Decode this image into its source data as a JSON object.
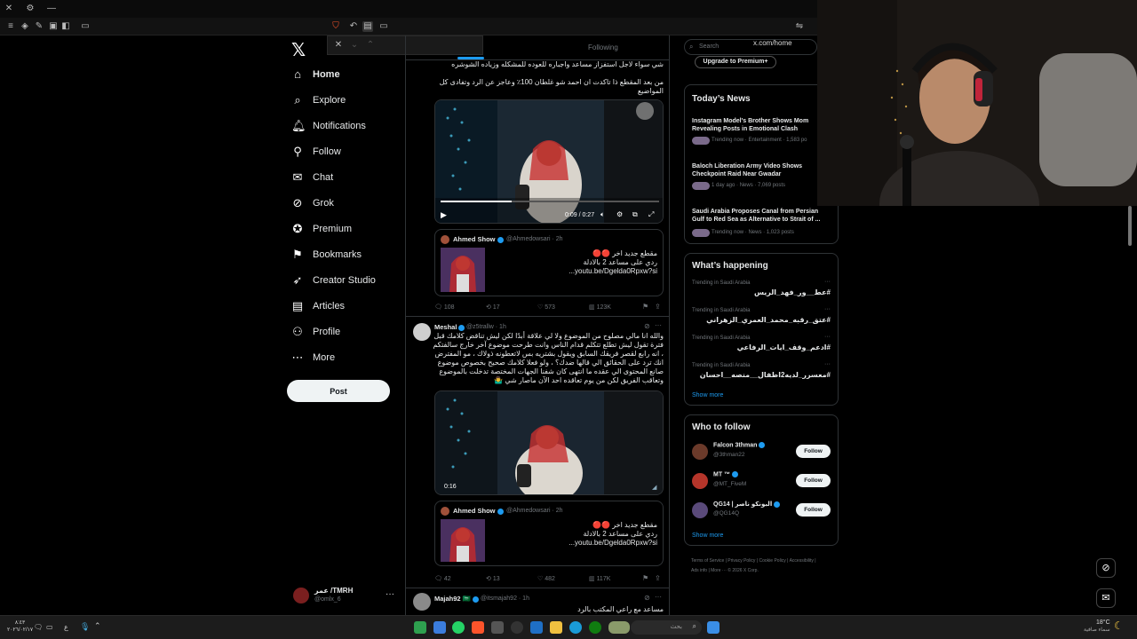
{
  "browser": {
    "url": "x.com/home",
    "title_controls": [
      "✕",
      "⚙",
      "—"
    ]
  },
  "nav": {
    "items": [
      {
        "label": "Home",
        "icon": "home-icon",
        "glyph": "⌂",
        "active": true
      },
      {
        "label": "Explore",
        "icon": "search-icon",
        "glyph": "⌕"
      },
      {
        "label": "Notifications",
        "icon": "bell-icon",
        "glyph": "🔔︎"
      },
      {
        "label": "Follow",
        "icon": "person-plus-icon",
        "glyph": "⚲"
      },
      {
        "label": "Chat",
        "icon": "mail-icon",
        "glyph": "✉"
      },
      {
        "label": "Grok",
        "icon": "grok-icon",
        "glyph": "⊘"
      },
      {
        "label": "Premium",
        "icon": "premium-icon",
        "glyph": "✪"
      },
      {
        "label": "Bookmarks",
        "icon": "bookmark-icon",
        "glyph": "⚑"
      },
      {
        "label": "Creator Studio",
        "icon": "rocket-icon",
        "glyph": "➶"
      },
      {
        "label": "Articles",
        "icon": "articles-icon",
        "glyph": "▤"
      },
      {
        "label": "Profile",
        "icon": "profile-icon",
        "glyph": "⚇"
      },
      {
        "label": "More",
        "icon": "more-circle-icon",
        "glyph": "⋯"
      }
    ],
    "post_label": "Post",
    "account": {
      "name": "عمر /TMRH",
      "handle": "@omlx_6"
    }
  },
  "timeline": {
    "tab_following": "Following",
    "post1": {
      "text_top": "شي سواء لاجل استفزاز مساعد واجباره للعوده للمشكله وزياده الشوشره",
      "text_main": "من بعد المقطع ذا تاكدت ان احمد شو غلطان 100٪ وعاجز عن الرد وتفادى كل المواضيع",
      "video_time": "0:09 / 0:27",
      "quote": {
        "name": "Ahmed Show",
        "handle": "@Ahmedowsari · 2h",
        "text": "مقطع جديد اخر 🔴🔴\nردي على مساعد 2 بالادلة\nyoutu.be/Dgelda0Rpxw?si..."
      },
      "stats": {
        "replies": "108",
        "reposts": "17",
        "likes": "573",
        "views": "123K"
      }
    },
    "post2": {
      "name": "Meshal",
      "handle": "@z5trallw · 1h",
      "text": "والله انا مالي مصلوح من الموضوع ولا لي علاقة أبدًا لكن ليش تناقض كلامك قبل فترة تقول ليش تطلع تتكلم قدام الناس وانت طرحت موضوع آخر خارج سالفتكم ، انه رابع لقصر فريقك السابق ويقول بشتريه بس لاتعطونه ذولاك ، مو المفترض انك ترد على الحقائق الي قالها ضدك؟ ، ولو فعلا كلامك صحيح بخصوص موضوع صانع المحتوى الي عقده ما انتهى كان شفنا الجهات المختصة تدخلت بالموضوع وتعاقب الفريق لكن من يوم تعاقده احد الآن ماصار شي 🤷‍♂️",
      "video_time": "0:16",
      "quote": {
        "name": "Ahmed Show",
        "handle": "@Ahmedowsari · 2h",
        "text": "مقطع جديد اخر 🔴🔴\nردي على مساعد 2 بالادلة\nyoutu.be/Dgelda0Rpxw?si..."
      },
      "stats": {
        "replies": "42",
        "reposts": "13",
        "likes": "482",
        "views": "117K"
      }
    },
    "post3": {
      "name": "Majah92 🇸🇦",
      "handle": "@itsmajah92 · 1h",
      "text": "مساعد مع راعي المكتب بالرد"
    }
  },
  "right": {
    "search_placeholder": "Search",
    "upgrade_label": "Upgrade to Premium+",
    "todays_news": {
      "title": "Today’s News",
      "items": [
        {
          "title": "Instagram Model's Brother Shows Mom Revealing Posts in Emotional Clash",
          "meta": "Trending now · Entertainment · 1,583 po"
        },
        {
          "title": "Baloch Liberation Army Video Shows Checkpoint Raid Near Gwadar",
          "meta": "1 day ago · News · 7,069 posts"
        },
        {
          "title": "Saudi Arabia Proposes Canal from Persian Gulf to Red Sea as Alternative to Strait of ...",
          "meta": "Trending now · News · 1,023 posts"
        }
      ]
    },
    "happening": {
      "title": "What’s happening",
      "trends": [
        {
          "context": "Trending in Saudi Arabia",
          "tag": "#عط__ور_فهد_الريس"
        },
        {
          "context": "Trending in Saudi Arabia",
          "tag": "#عتق_رقبه_محمد_العمري_الزهراني"
        },
        {
          "context": "Trending in Saudi Arabia",
          "tag": "#ادعم_وقف_ايات_الرفاعي"
        },
        {
          "context": "Trending in Saudi Arabia",
          "tag": "#معسرر_لديه2اطفال__منصه__احسان"
        }
      ],
      "show_more": "Show more"
    },
    "who_to_follow": {
      "title": "Who to follow",
      "users": [
        {
          "name": "Falcon 3thman",
          "handle": "@3thman22",
          "color": "#6b3a2a"
        },
        {
          "name": "MT ™",
          "handle": "@MT_FiveM",
          "color": "#b5352a"
        },
        {
          "name": "QG14 | البونكو ناصر",
          "handle": "@QG14Q",
          "color": "#5a4a7a"
        }
      ],
      "follow_label": "Follow",
      "show_more": "Show more"
    },
    "footer": "Terms of Service  |  Privacy Policy  |  Cookie Policy  |  Accessibility  |  Ads info  |  More ···  © 2026 X Corp."
  },
  "taskbar": {
    "search_placeholder": "بحث",
    "weather": "18°C",
    "weather_text": "سماء صافية",
    "time": "٨:٤٣",
    "date": "٢٠٢٦/٠٢/١٧",
    "lang": "ع"
  }
}
